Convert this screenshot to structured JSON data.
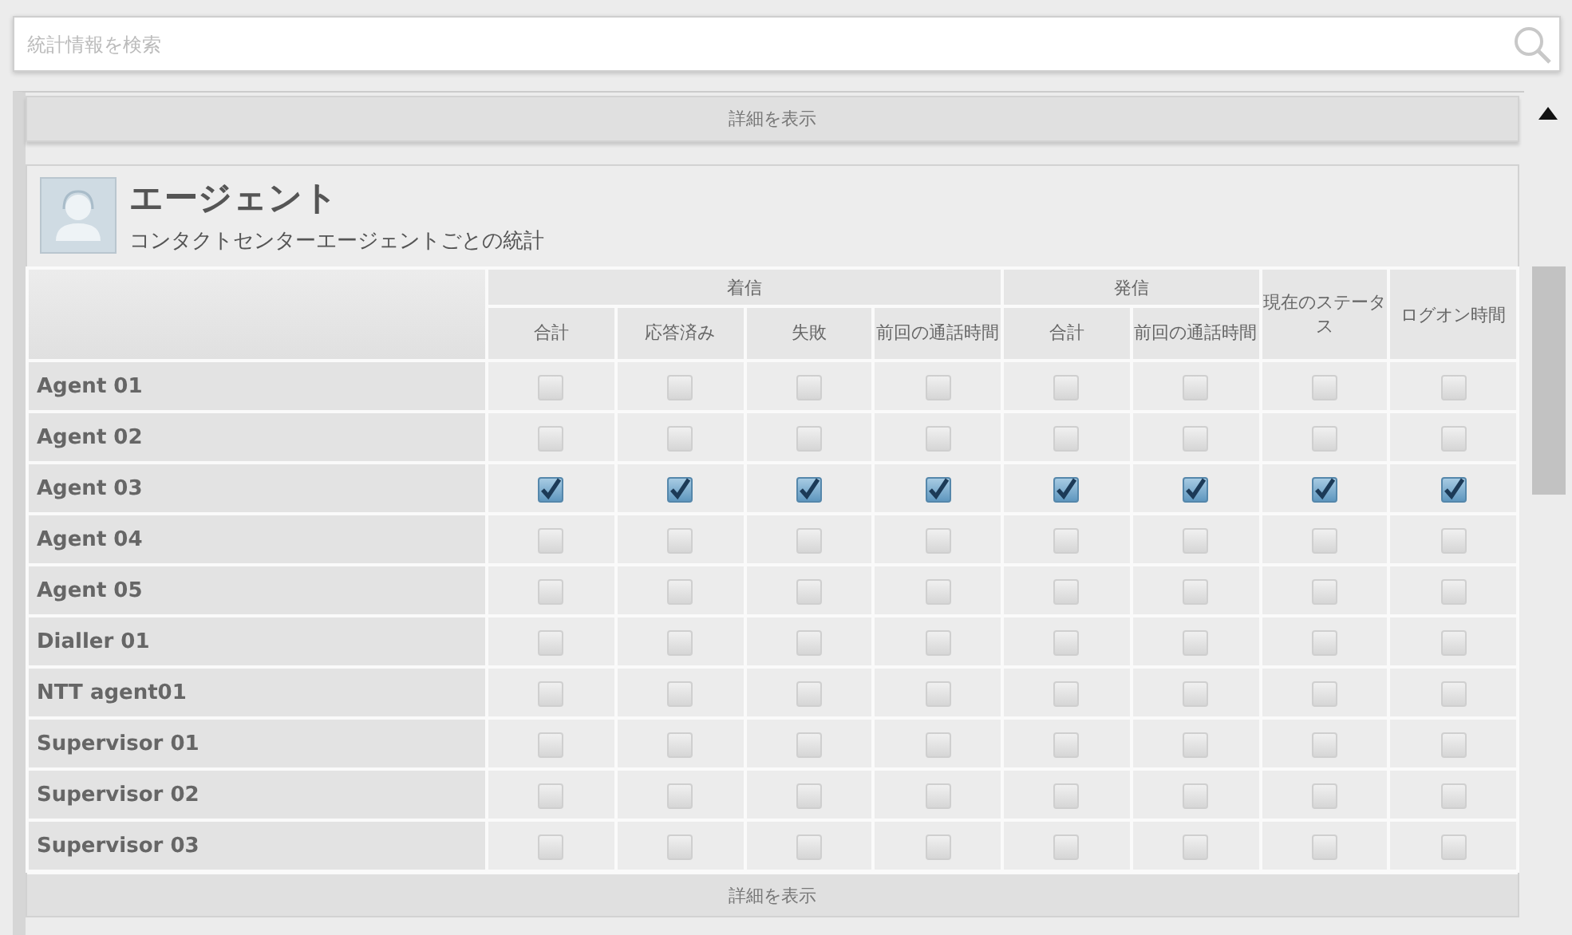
{
  "search": {
    "placeholder": "統計情報を検索"
  },
  "top_button": "詳細を表示",
  "section": {
    "title": "エージェント",
    "subtitle": "コンタクトセンターエージェントごとの統計"
  },
  "table": {
    "groups": [
      {
        "label": "着信",
        "columns": [
          "合計",
          "応答済み",
          "失敗",
          "前回の通話時間"
        ]
      },
      {
        "label": "発信",
        "columns": [
          "合計",
          "前回の通話時間"
        ]
      }
    ],
    "single_columns": [
      "現在のステータス",
      "ログオン時間"
    ],
    "rows": [
      {
        "name": "Agent 01",
        "checked": [
          false,
          false,
          false,
          false,
          false,
          false,
          false,
          false
        ]
      },
      {
        "name": "Agent 02",
        "checked": [
          false,
          false,
          false,
          false,
          false,
          false,
          false,
          false
        ]
      },
      {
        "name": "Agent 03",
        "checked": [
          true,
          true,
          true,
          true,
          true,
          true,
          true,
          true
        ]
      },
      {
        "name": "Agent 04",
        "checked": [
          false,
          false,
          false,
          false,
          false,
          false,
          false,
          false
        ]
      },
      {
        "name": "Agent 05",
        "checked": [
          false,
          false,
          false,
          false,
          false,
          false,
          false,
          false
        ]
      },
      {
        "name": "Dialler 01",
        "checked": [
          false,
          false,
          false,
          false,
          false,
          false,
          false,
          false
        ]
      },
      {
        "name": "NTT agent01",
        "checked": [
          false,
          false,
          false,
          false,
          false,
          false,
          false,
          false
        ]
      },
      {
        "name": "Supervisor 01",
        "checked": [
          false,
          false,
          false,
          false,
          false,
          false,
          false,
          false
        ]
      },
      {
        "name": "Supervisor 02",
        "checked": [
          false,
          false,
          false,
          false,
          false,
          false,
          false,
          false
        ]
      },
      {
        "name": "Supervisor 03",
        "checked": [
          false,
          false,
          false,
          false,
          false,
          false,
          false,
          false
        ]
      }
    ]
  },
  "bottom_button": "詳細を表示"
}
